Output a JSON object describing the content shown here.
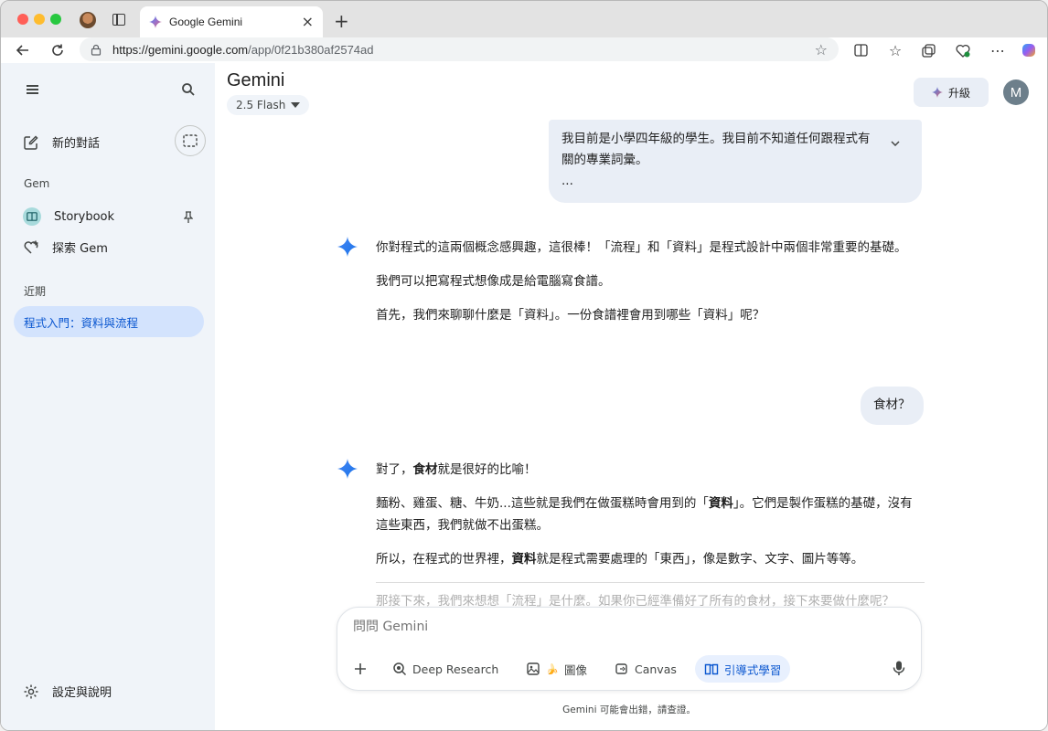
{
  "browser": {
    "tab_title": "Google Gemini",
    "new_tab_label": "+",
    "tab_close_label": "×",
    "url_host": "https://gemini.google.com",
    "url_path": "/app/0f21b380af2574ad"
  },
  "sidebar": {
    "new_chat_label": "新的對話",
    "gem_heading": "Gem",
    "storybook_label": "Storybook",
    "explore_gem_label": "探索 Gem",
    "recent_heading": "近期",
    "recent_chat_title": "程式入門：資料與流程",
    "settings_label": "設定與說明"
  },
  "header": {
    "app_title": "Gemini",
    "model_label": "2.5 Flash",
    "upgrade_label": "升級",
    "avatar_initial": "M"
  },
  "conversation": {
    "user_message_1_line1": "我目前是小學四年級的學生。我目前不知道任何跟程式有",
    "user_message_1_line2": "關的專業詞彙。",
    "user_message_1_line3": "...",
    "response_1": [
      "你對程式的這兩個概念感興趣，這很棒！「流程」和「資料」是程式設計中兩個非常重要的基礎。",
      "我們可以把寫程式想像成是給電腦寫食譜。",
      "首先，我們來聊聊什麼是「資料」。一份食譜裡會用到哪些「資料」呢？"
    ],
    "user_message_2": "食材？",
    "response_2": {
      "p1_a": "對了，",
      "p1_bold": "食材",
      "p1_b": "就是很好的比喻！",
      "p2_a": "麵粉、雞蛋、糖、牛奶...這些就是我們在做蛋糕時會用到的「",
      "p2_bold": "資料",
      "p2_b": "」。它們是製作蛋糕的基礎，沒有這些東西，我們就做不出蛋糕。",
      "p3_a": "所以，在程式的世界裡，",
      "p3_bold": "資料",
      "p3_b": "就是程式需要處理的「東西」，像是數字、文字、圖片等等。",
      "p4_faded": "那接下來，我們來想想「流程」是什麼。如果你已經準備好了所有的食材，接下來要做什麼呢？"
    }
  },
  "composer": {
    "placeholder": "問問 Gemini",
    "tools": {
      "deep_research": "Deep Research",
      "image": "圖像",
      "canvas": "Canvas",
      "guided_learning": "引導式學習"
    },
    "disclaimer": "Gemini 可能會出錯，請查證。"
  },
  "colors": {
    "sidebar_bg": "#f0f4f9",
    "selected_chat_bg": "#d3e3fd",
    "accent_blue": "#0b57d0",
    "user_bubble_bg": "#e9eef6"
  },
  "icons": [
    "menu-icon",
    "search-icon",
    "edit-icon",
    "temporary-chat-icon",
    "storybook-icon",
    "pin-icon",
    "gem-plus-icon",
    "settings-icon",
    "spark-icon",
    "chevron-down-icon",
    "plus-icon",
    "deep-research-icon",
    "image-icon",
    "canvas-icon",
    "guided-learning-icon",
    "mic-icon"
  ]
}
